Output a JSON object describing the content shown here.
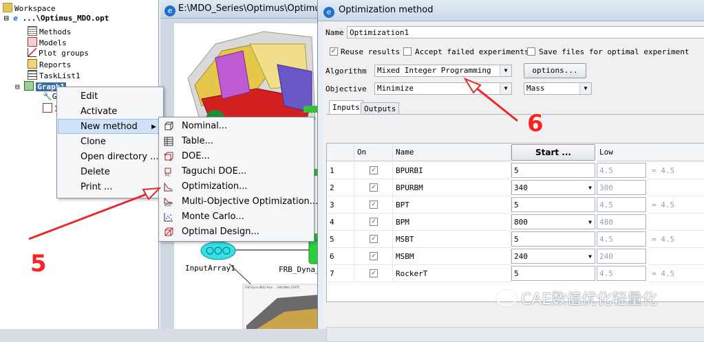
{
  "tree": {
    "root": "Workspace",
    "project": "...\\Optimus_MDO.opt",
    "items": [
      "Methods",
      "Models",
      "Plot groups",
      "Reports",
      "TaskList1"
    ],
    "selected": "Graph1",
    "children": [
      "G",
      "I"
    ]
  },
  "graph_window": {
    "title": "E:\\MDO_Series\\Optimus\\Optimus_",
    "nodes": [
      "InputArray1",
      "FRB_Dyna_"
    ]
  },
  "context_menu": {
    "items": [
      "Edit",
      "Activate",
      "New method",
      "Clone",
      "Open directory ...",
      "Delete",
      "Print ..."
    ],
    "submenu_arrow": "▶"
  },
  "submenu": {
    "items": [
      "Nominal...",
      "Table...",
      "DOE...",
      "Taguchi DOE...",
      "Optimization...",
      "Multi-Objective Optimization...",
      "Monte Carlo...",
      "Optimal Design..."
    ]
  },
  "dialog": {
    "title": "Optimization method",
    "name_label": "Name",
    "name_value": "Optimization1",
    "checkboxes": [
      {
        "label": "Reuse results",
        "checked": true
      },
      {
        "label": "Accept failed experiments",
        "checked": false
      },
      {
        "label": "Save files for optimal experiment",
        "checked": false
      }
    ],
    "algorithm_label": "Algorithm",
    "algorithm_value": "Mixed Integer Programming",
    "options_button": "options...",
    "objective_label": "Objective",
    "objective_value": "Minimize",
    "objective_target": "Mass",
    "tabs": [
      "Inputs",
      "Outputs"
    ],
    "start_button": "Start ...",
    "columns": [
      "On",
      "Name",
      "Low"
    ],
    "rows": [
      {
        "n": "1",
        "name": "BPURBI",
        "start": "5",
        "low": "4.5",
        "eq": "= 4.5",
        "combo": false
      },
      {
        "n": "2",
        "name": "BPURBM",
        "start": "340",
        "low": "300",
        "eq": "",
        "combo": true
      },
      {
        "n": "3",
        "name": "BPT",
        "start": "5",
        "low": "4.5",
        "eq": "= 4.5",
        "combo": false
      },
      {
        "n": "4",
        "name": "BPM",
        "start": "800",
        "low": "480",
        "eq": "",
        "combo": true
      },
      {
        "n": "5",
        "name": "MSBT",
        "start": "5",
        "low": "4.5",
        "eq": "= 4.5",
        "combo": false
      },
      {
        "n": "6",
        "name": "MSBM",
        "start": "240",
        "low": "240",
        "eq": "",
        "combo": true
      },
      {
        "n": "7",
        "name": "RockerT",
        "start": "5",
        "low": "4.5",
        "eq": "= 4.5",
        "combo": false
      }
    ]
  },
  "annotations": {
    "step5": "5",
    "step6": "6",
    "watermark": "CAE数值优化轻量化"
  },
  "colors": {
    "arrow": "#e8282a",
    "selection": "#3a6ea5",
    "highlight": "#cfe2f7"
  }
}
